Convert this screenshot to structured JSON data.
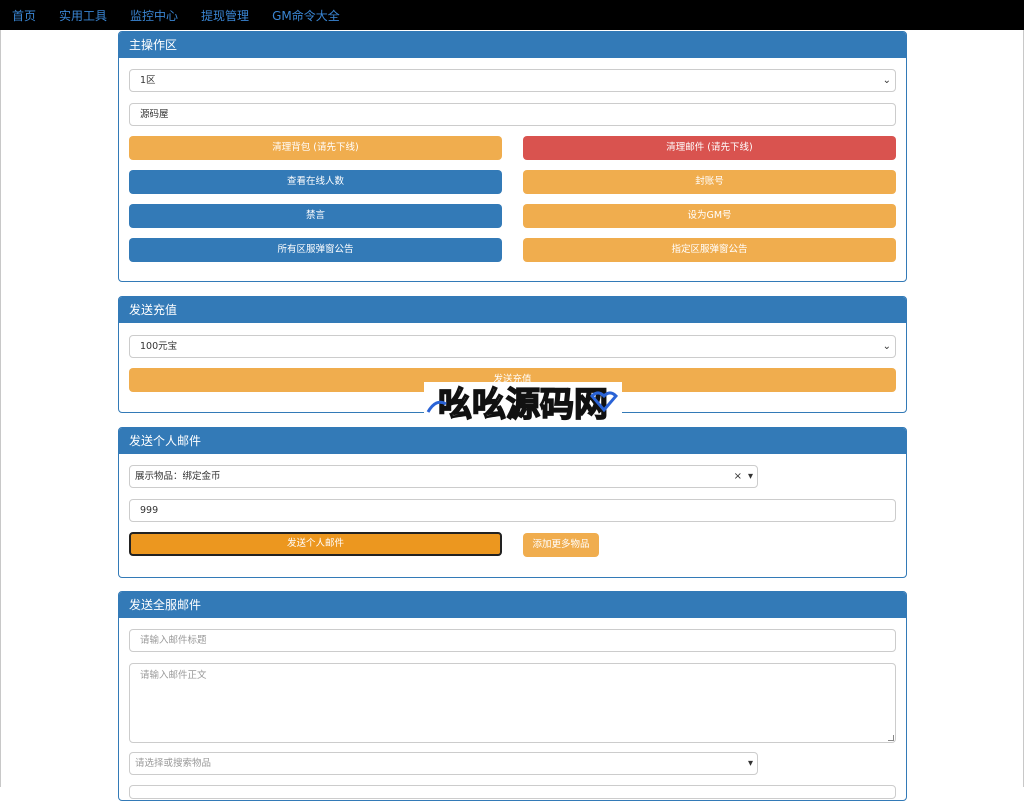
{
  "nav": {
    "items": [
      "首页",
      "实用工具",
      "监控中心",
      "提现管理",
      "GM命令大全"
    ]
  },
  "main_panel": {
    "title": "主操作区",
    "server_select": "1区",
    "name_input": "源码屋",
    "buttons": {
      "clear_bag": "清理背包 (请先下线)",
      "clear_mail": "清理邮件 (请先下线)",
      "online_count": "查看在线人数",
      "ban_account": "封账号",
      "mute": "禁言",
      "set_gm": "设为GM号",
      "all_popup": "所有区服弹窗公告",
      "server_popup": "指定区服弹窗公告"
    }
  },
  "recharge_panel": {
    "title": "发送充值",
    "amount_select": "100元宝",
    "send_button": "发送充值"
  },
  "personal_mail_panel": {
    "title": "发送个人邮件",
    "item_select": "展示物品：绑定金币",
    "clear_mark": "×",
    "quantity": "999",
    "send_button": "发送个人邮件",
    "add_more_button": "添加更多物品"
  },
  "global_mail_panel": {
    "title": "发送全服邮件",
    "subject_placeholder": "请输入邮件标题",
    "body_placeholder": "请输入邮件正文",
    "item_placeholder": "请选择或搜索物品"
  },
  "watermark": {
    "text": "吆吆源码网"
  },
  "colors": {
    "primary": "#337ab7",
    "warning": "#f0ad4e",
    "danger": "#d9534f",
    "nav_bg": "#000000",
    "nav_link": "#3a86d4"
  },
  "icons": {
    "dropdown": "chevron-down-icon",
    "clear": "close-icon"
  }
}
